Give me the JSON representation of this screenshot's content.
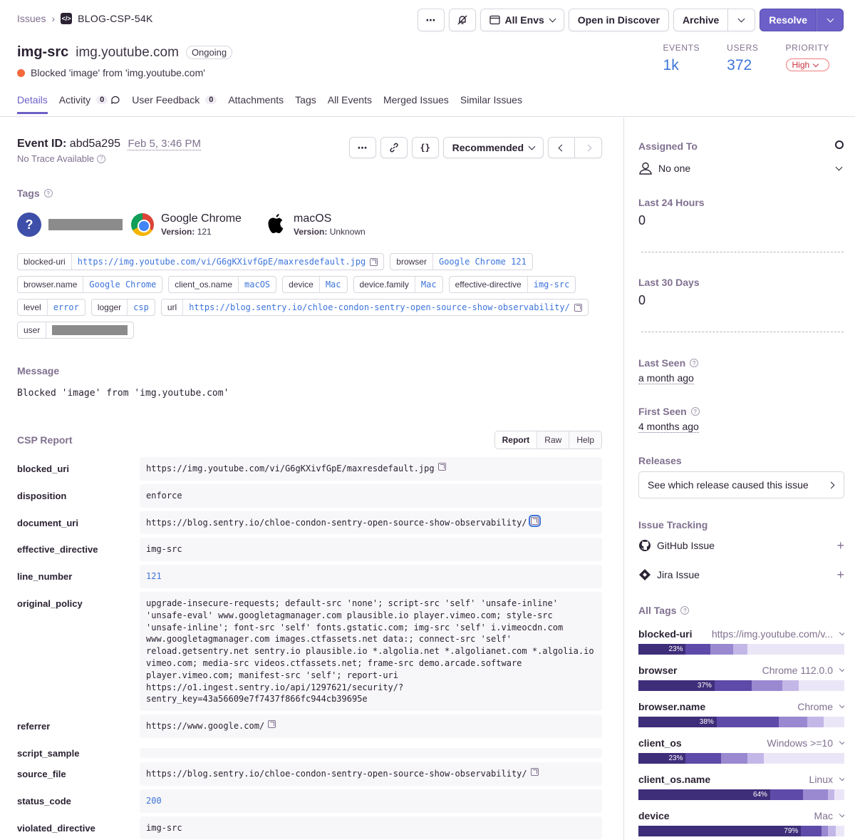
{
  "breadcrumb": {
    "parent": "Issues",
    "short_id": "BLOG-CSP-54K"
  },
  "actions": {
    "more": "⋯",
    "env": "All Envs",
    "open_discover": "Open in Discover",
    "archive": "Archive",
    "resolve": "Resolve"
  },
  "issue": {
    "type": "img-src",
    "value": "img.youtube.com",
    "status": "Ongoing",
    "message": "Blocked 'image' from 'img.youtube.com'"
  },
  "stats": {
    "events_label": "EVENTS",
    "events": "1k",
    "users_label": "USERS",
    "users": "372",
    "priority_label": "PRIORITY",
    "priority": "High"
  },
  "tabs": [
    {
      "label": "Details"
    },
    {
      "label": "Activity",
      "count": "0"
    },
    {
      "label": "User Feedback",
      "count": "0"
    },
    {
      "label": "Attachments"
    },
    {
      "label": "Tags"
    },
    {
      "label": "All Events"
    },
    {
      "label": "Merged Issues"
    },
    {
      "label": "Similar Issues"
    }
  ],
  "event": {
    "id_label": "Event ID:",
    "id": "abd5a295",
    "date": "Feb 5, 3:46 PM",
    "no_trace": "No Trace Available",
    "recommended": "Recommended",
    "more": "⋯",
    "json": "{}"
  },
  "tags_title": "Tags",
  "highlights": {
    "user_icon": "?",
    "browser_name": "Google Chrome",
    "browser_ver_label": "Version:",
    "browser_ver": "121",
    "os_name": "macOS",
    "os_ver_label": "Version:",
    "os_ver": "Unknown"
  },
  "tag_pills": [
    [
      {
        "k": "blocked-uri",
        "v": "https://img.youtube.com/vi/G6gKXivfGpE/maxresdefault.jpg",
        "ext": true
      },
      {
        "k": "browser",
        "v": "Google Chrome 121"
      }
    ],
    [
      {
        "k": "browser.name",
        "v": "Google Chrome"
      },
      {
        "k": "client_os.name",
        "v": "macOS"
      },
      {
        "k": "device",
        "v": "Mac"
      },
      {
        "k": "device.family",
        "v": "Mac"
      },
      {
        "k": "effective-directive",
        "v": "img-src"
      }
    ],
    [
      {
        "k": "level",
        "v": "error"
      },
      {
        "k": "logger",
        "v": "csp"
      },
      {
        "k": "url",
        "v": "https://blog.sentry.io/chloe-condon-sentry-open-source-show-observability/",
        "ext": true
      }
    ],
    [
      {
        "k": "user",
        "v": "",
        "redacted": true
      }
    ]
  ],
  "message_title": "Message",
  "message_text": "Blocked 'image' from 'img.youtube.com'",
  "csp_title": "CSP Report",
  "csp_tabs": [
    "Report",
    "Raw",
    "Help"
  ],
  "csp_report": [
    {
      "k": "blocked_uri",
      "v": "https://img.youtube.com/vi/G6gKXivfGpE/maxresdefault.jpg",
      "ext": true
    },
    {
      "k": "disposition",
      "v": "enforce"
    },
    {
      "k": "document_uri",
      "v": "https://blog.sentry.io/chloe-condon-sentry-open-source-show-observability/",
      "ext": true,
      "focused": true
    },
    {
      "k": "effective_directive",
      "v": "img-src"
    },
    {
      "k": "line_number",
      "v": "121",
      "num": true
    },
    {
      "k": "original_policy",
      "v": "upgrade-insecure-requests; default-src 'none'; script-src 'self' 'unsafe-inline' 'unsafe-eval' www.googletagmanager.com plausible.io player.vimeo.com; style-src 'unsafe-inline'; font-src 'self' fonts.gstatic.com; img-src 'self' i.vimeocdn.com www.googletagmanager.com images.ctfassets.net data:; connect-src 'self' reload.getsentry.net sentry.io plausible.io *.algolia.net *.algolianet.com *.algolia.io vimeo.com; media-src videos.ctfassets.net; frame-src demo.arcade.software player.vimeo.com; manifest-src 'self'; report-uri https://o1.ingest.sentry.io/api/1297621/security/?sentry_key=43a56609e7f7437f866fc944cb39695e"
    },
    {
      "k": "referrer",
      "v": "https://www.google.com/",
      "ext": true
    },
    {
      "k": "script_sample",
      "v": ""
    },
    {
      "k": "source_file",
      "v": "https://blog.sentry.io/chloe-condon-sentry-open-source-show-observability/",
      "ext": true
    },
    {
      "k": "status_code",
      "v": "200",
      "num": true
    },
    {
      "k": "violated_directive",
      "v": "img-src"
    }
  ],
  "sidebar": {
    "assigned_title": "Assigned To",
    "assigned_value": "No one",
    "last24_title": "Last 24 Hours",
    "last24_value": "0",
    "last30_title": "Last 30 Days",
    "last30_value": "0",
    "last_seen_title": "Last Seen",
    "last_seen_value": "a month ago",
    "first_seen_title": "First Seen",
    "first_seen_value": "4 months ago",
    "releases_title": "Releases",
    "releases_button": "See which release caused this issue",
    "tracking_title": "Issue Tracking",
    "github": "GitHub Issue",
    "jira": "Jira Issue",
    "all_tags_title": "All Tags"
  },
  "all_tags": [
    {
      "k": "blocked-uri",
      "v": "https://img.youtube.com/v...",
      "pct": "23%",
      "segs": [
        23,
        12,
        11,
        7
      ]
    },
    {
      "k": "browser",
      "v": "Chrome 112.0.0",
      "pct": "37%",
      "segs": [
        37,
        18,
        15,
        8
      ]
    },
    {
      "k": "browser.name",
      "v": "Chrome",
      "pct": "38%",
      "segs": [
        38,
        30,
        14,
        8
      ]
    },
    {
      "k": "client_os",
      "v": "Windows >=10",
      "pct": "23%",
      "segs": [
        23,
        17,
        13,
        8
      ]
    },
    {
      "k": "client_os.name",
      "v": "Linux",
      "pct": "64%",
      "segs": [
        64,
        16,
        12,
        3
      ]
    },
    {
      "k": "device",
      "v": "Mac",
      "pct": "79%",
      "segs": [
        79,
        10,
        3,
        4
      ]
    }
  ],
  "colors": {
    "accent": "#6c5fc7",
    "link": "#3d74db",
    "status_dot": "#f5693d",
    "priority": "#c8323c"
  }
}
